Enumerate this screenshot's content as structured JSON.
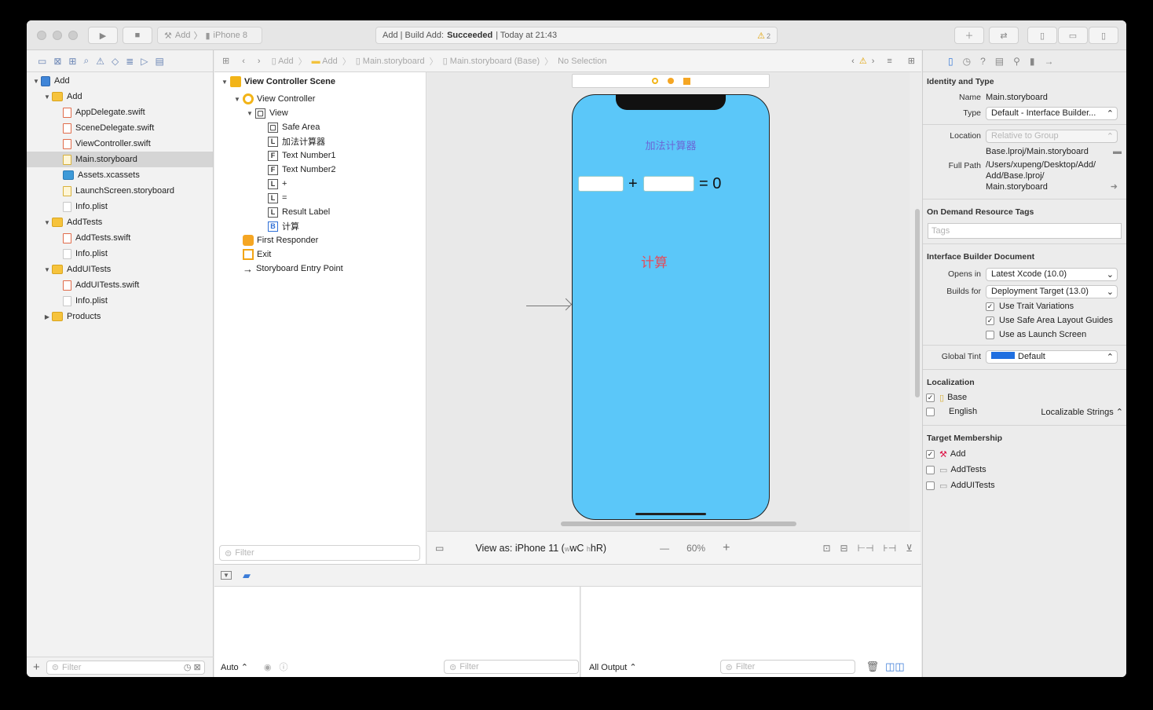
{
  "toolbar": {
    "scheme": "Add",
    "device": "iPhone 8",
    "status_prefix": "Add | Build Add:",
    "status_result": "Succeeded",
    "status_time": "| Today at 21:43",
    "warning_count": "2"
  },
  "navigator": {
    "items": [
      {
        "label": "Add",
        "icon": "project-icon",
        "depth": 0,
        "expanded": true
      },
      {
        "label": "Add",
        "icon": "folder-icon",
        "depth": 1,
        "expanded": true
      },
      {
        "label": "AppDelegate.swift",
        "icon": "swift-file-icon",
        "depth": 2
      },
      {
        "label": "SceneDelegate.swift",
        "icon": "swift-file-icon",
        "depth": 2
      },
      {
        "label": "ViewController.swift",
        "icon": "swift-file-icon",
        "depth": 2
      },
      {
        "label": "Main.storyboard",
        "icon": "storyboard-icon",
        "depth": 2,
        "selected": true
      },
      {
        "label": "Assets.xcassets",
        "icon": "assets-icon",
        "depth": 2
      },
      {
        "label": "LaunchScreen.storyboard",
        "icon": "storyboard-icon",
        "depth": 2
      },
      {
        "label": "Info.plist",
        "icon": "plist-icon",
        "depth": 2
      },
      {
        "label": "AddTests",
        "icon": "folder-icon",
        "depth": 1,
        "expanded": true
      },
      {
        "label": "AddTests.swift",
        "icon": "swift-file-icon",
        "depth": 2
      },
      {
        "label": "Info.plist",
        "icon": "plist-icon",
        "depth": 2
      },
      {
        "label": "AddUITests",
        "icon": "folder-icon",
        "depth": 1,
        "expanded": true
      },
      {
        "label": "AddUITests.swift",
        "icon": "swift-file-icon",
        "depth": 2
      },
      {
        "label": "Info.plist",
        "icon": "plist-icon",
        "depth": 2
      },
      {
        "label": "Products",
        "icon": "folder-icon",
        "depth": 1,
        "expanded": false
      }
    ],
    "filter_placeholder": "Filter"
  },
  "jumpbar": {
    "crumbs": [
      "Add",
      "Add",
      "Main.storyboard",
      "Main.storyboard (Base)",
      "No Selection"
    ]
  },
  "outline": {
    "scene": "View Controller Scene",
    "controller": "View Controller",
    "view": "View",
    "children": [
      {
        "badge": "▢",
        "label": "Safe Area"
      },
      {
        "badge": "L",
        "label": "加法计算器"
      },
      {
        "badge": "F",
        "label": "Text Number1"
      },
      {
        "badge": "F",
        "label": "Text Number2"
      },
      {
        "badge": "L",
        "label": "+"
      },
      {
        "badge": "L",
        "label": "="
      },
      {
        "badge": "L",
        "label": "Result Label"
      },
      {
        "badge": "B",
        "label": "计算"
      }
    ],
    "first_responder": "First Responder",
    "exit": "Exit",
    "entry_point": "Storyboard Entry Point",
    "filter_placeholder": "Filter"
  },
  "canvas": {
    "title": "加法计算器",
    "plus": "+",
    "equals": "= 0",
    "button": "计算",
    "view_as": "View as: iPhone 11 (",
    "size_w": "wC",
    "size_h": "hR)",
    "zoom_minus": "—",
    "zoom": "60%",
    "zoom_plus": "+"
  },
  "debug": {
    "auto": "Auto",
    "filter_placeholder": "Filter",
    "output": "All Output"
  },
  "inspector": {
    "identity_title": "Identity and Type",
    "name_label": "Name",
    "name_value": "Main.storyboard",
    "type_label": "Type",
    "type_value": "Default - Interface Builder...",
    "location_label": "Location",
    "location_value": "Relative to Group",
    "location_path": "Base.lproj/Main.storyboard",
    "fullpath_label": "Full Path",
    "fullpath_1": "/Users/xupeng/Desktop/Add/",
    "fullpath_2": "Add/Base.lproj/",
    "fullpath_3": "Main.storyboard",
    "odr_title": "On Demand Resource Tags",
    "tags_placeholder": "Tags",
    "ibd_title": "Interface Builder Document",
    "opens_label": "Opens in",
    "opens_value": "Latest Xcode (10.0)",
    "builds_label": "Builds for",
    "builds_value": "Deployment Target (13.0)",
    "trait": "Use Trait Variations",
    "safearea": "Use Safe Area Layout Guides",
    "launch": "Use as Launch Screen",
    "tint_label": "Global Tint",
    "tint_value": "Default",
    "loc_title": "Localization",
    "loc_base": "Base",
    "loc_english": "English",
    "loc_strings": "Localizable Strings",
    "tm_title": "Target Membership",
    "tm_add": "Add",
    "tm_tests": "AddTests",
    "tm_uitests": "AddUITests"
  },
  "colors": {
    "phone_bg": "#5bc7f9",
    "title_text": "#6b67d6",
    "button_text": "#e54b5a",
    "accent": "#3b7cd8"
  }
}
